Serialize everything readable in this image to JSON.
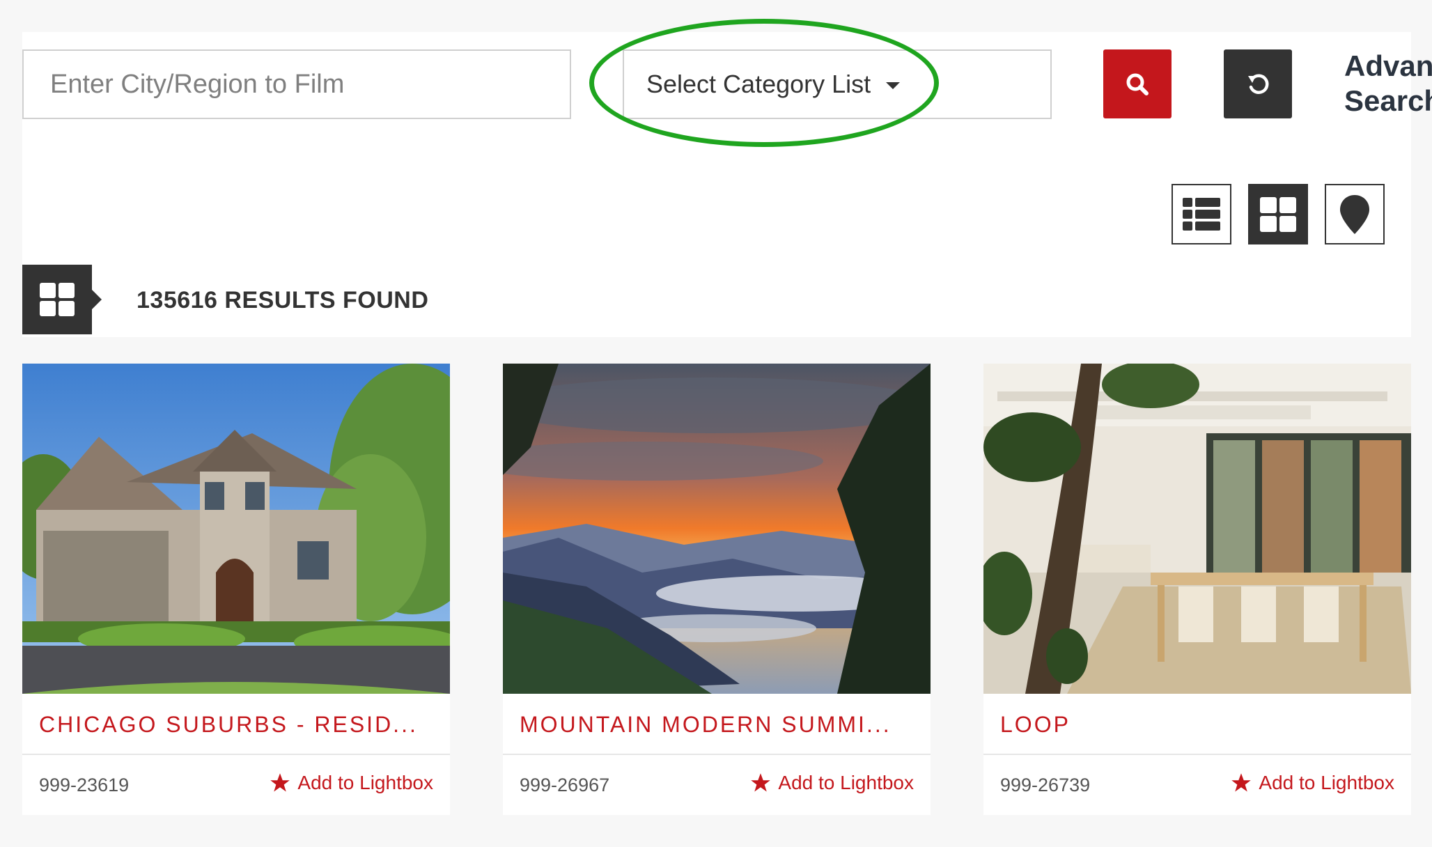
{
  "search": {
    "city_placeholder": "Enter City/Region to Film",
    "category_label": "Select Category List",
    "advanced_line1": "Advan",
    "advanced_line2": "Search"
  },
  "results": {
    "count_text": "135616 RESULTS FOUND"
  },
  "colors": {
    "brand_red": "#c4171c",
    "dark": "#333333",
    "annotation_green": "#1fa51f"
  },
  "cards": [
    {
      "title": "CHICAGO SUBURBS - RESID...",
      "id": "999-23619",
      "lightbox_label": "Add to Lightbox"
    },
    {
      "title": "MOUNTAIN MODERN SUMMI...",
      "id": "999-26967",
      "lightbox_label": "Add to Lightbox"
    },
    {
      "title": "LOOP",
      "id": "999-26739",
      "lightbox_label": "Add to Lightbox"
    }
  ]
}
